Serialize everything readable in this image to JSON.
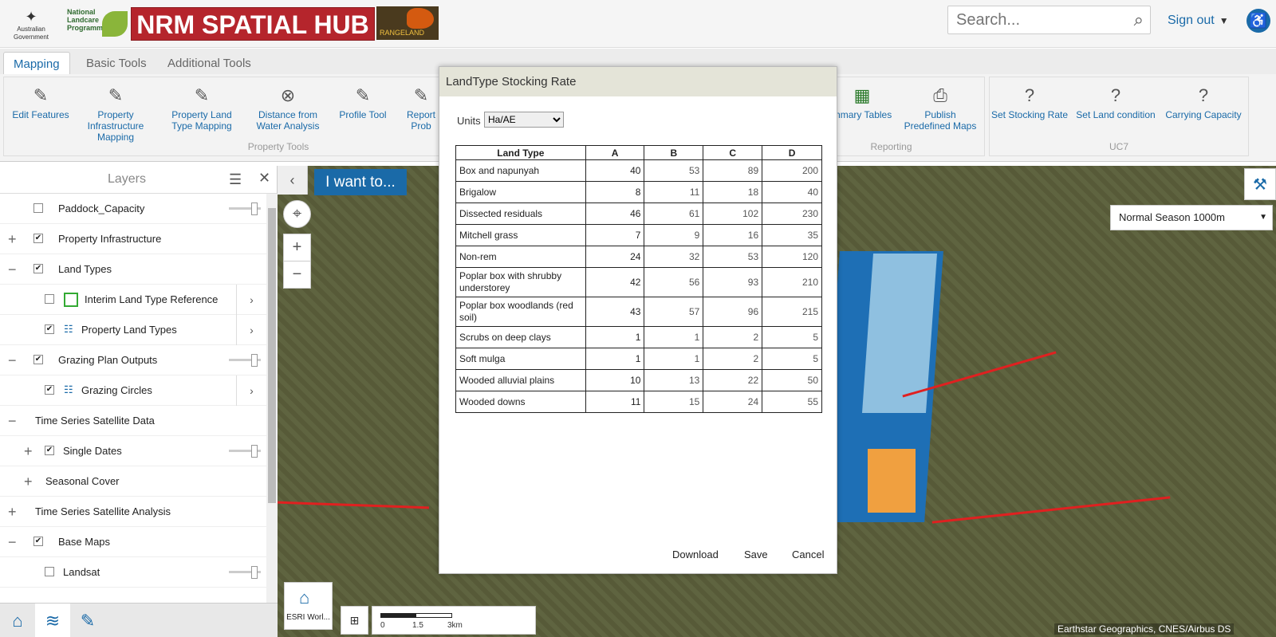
{
  "header": {
    "gov_logo": "Australian Government",
    "landcare": "National Landcare Programme",
    "hub_title": "NRM SPATIAL HUB",
    "rangeland": "RANGELAND",
    "search_placeholder": "Search...",
    "signout": "Sign out"
  },
  "tabs": [
    {
      "label": "Mapping"
    },
    {
      "label": "Basic Tools"
    },
    {
      "label": "Additional Tools"
    }
  ],
  "ribbon": {
    "groups": {
      "property_tools": "Property Tools",
      "reporting": "Reporting",
      "uc7": "UC7"
    },
    "tools": [
      {
        "label": "Edit Features"
      },
      {
        "label": "Property Infrastructure Mapping"
      },
      {
        "label": "Property Land Type Mapping"
      },
      {
        "label": "Distance from Water Analysis"
      },
      {
        "label": "Profile Tool"
      },
      {
        "label": "Report Prob"
      },
      {
        "label": "mmary Tables"
      },
      {
        "label": "Publish Predefined Maps"
      },
      {
        "label": "Set Stocking Rate"
      },
      {
        "label": "Set Land condition"
      },
      {
        "label": "Carrying Capacity"
      }
    ]
  },
  "layers": {
    "title": "Layers",
    "items": [
      {
        "label": "Paddock_Capacity"
      },
      {
        "label": "Property Infrastructure"
      },
      {
        "label": "Land Types"
      },
      {
        "label": "Interim Land Type Reference"
      },
      {
        "label": "Property Land Types"
      },
      {
        "label": "Grazing Plan Outputs"
      },
      {
        "label": "Grazing Circles"
      },
      {
        "label": "Time Series Satellite Data"
      },
      {
        "label": "Single Dates"
      },
      {
        "label": "Seasonal Cover"
      },
      {
        "label": "Time Series Satellite Analysis"
      },
      {
        "label": "Base Maps"
      },
      {
        "label": "Landsat"
      }
    ]
  },
  "map": {
    "iwant": "I want to...",
    "season": "Normal Season 1000m",
    "basemap": "ESRI Worl...",
    "scale_labels": [
      "0",
      "1.5",
      "3km"
    ],
    "attribution": "Earthstar Geographics, CNES/Airbus DS"
  },
  "dialog": {
    "title": "LandType Stocking Rate",
    "units_label": "Units",
    "units_value": "Ha/AE",
    "columns": [
      "Land Type",
      "A",
      "B",
      "C",
      "D"
    ],
    "rows": [
      [
        "Box and napunyah",
        "40",
        "53",
        "89",
        "200"
      ],
      [
        "Brigalow",
        "8",
        "11",
        "18",
        "40"
      ],
      [
        "Dissected residuals",
        "46",
        "61",
        "102",
        "230"
      ],
      [
        "Mitchell grass",
        "7",
        "9",
        "16",
        "35"
      ],
      [
        "Non-rem",
        "24",
        "32",
        "53",
        "120"
      ],
      [
        "Poplar box with shrubby understorey",
        "42",
        "56",
        "93",
        "210"
      ],
      [
        "Poplar box woodlands (red soil)",
        "43",
        "57",
        "96",
        "215"
      ],
      [
        "Scrubs on deep clays",
        "1",
        "1",
        "2",
        "5"
      ],
      [
        "Soft mulga",
        "1",
        "1",
        "2",
        "5"
      ],
      [
        "Wooded alluvial plains",
        "10",
        "13",
        "22",
        "50"
      ],
      [
        "Wooded downs",
        "11",
        "15",
        "24",
        "55"
      ]
    ],
    "download": "Download",
    "save": "Save",
    "cancel": "Cancel"
  }
}
